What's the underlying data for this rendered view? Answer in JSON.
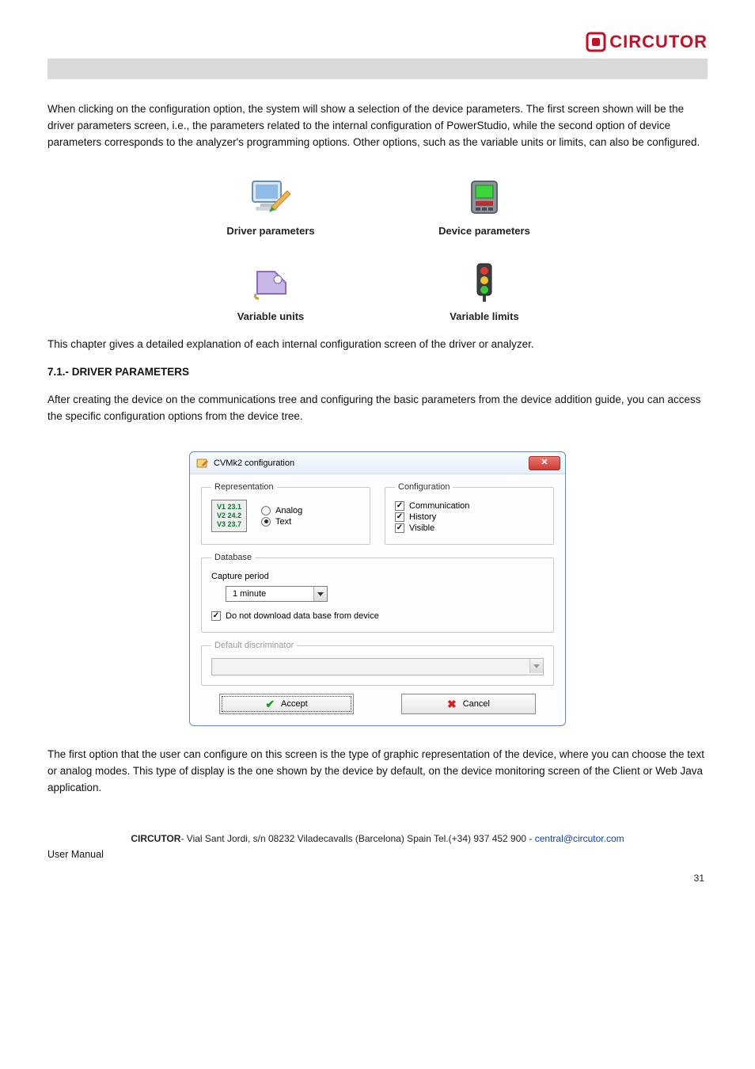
{
  "brand": "CIRCUTOR",
  "para1": "When clicking on the configuration option, the system will show a selection of the device parameters. The first screen shown will be the driver parameters screen, i.e., the parameters related to the internal configuration of PowerStudio, while the second option of device parameters corresponds to the analyzer's programming options. Other options, such as the variable units or limits, can also be configured.",
  "icons": {
    "driver": "Driver parameters",
    "device": "Device parameters",
    "units": "Variable units",
    "limits": "Variable limits"
  },
  "para2": "This chapter gives a detailed explanation of each internal configuration screen of the driver or analyzer.",
  "section_no": "7.1.-",
  "section_title": "DRIVER PARAMETERS",
  "para3": "After creating the device on the communications tree and configuring the basic parameters from the device addition guide, you can access the specific configuration options from the device tree.",
  "dialog": {
    "title": "CVMk2 configuration",
    "groups": {
      "representation": "Representation",
      "configuration": "Configuration",
      "database": "Database",
      "discriminator": "Default discriminator"
    },
    "mini": {
      "l1": "V1 23.1",
      "l2": "V2 24.2",
      "l3": "V3 23.7"
    },
    "radio": {
      "analog": "Analog",
      "text": "Text",
      "selected": "text"
    },
    "checks": {
      "communication": "Communication",
      "history": "History",
      "visible": "Visible"
    },
    "capture_label": "Capture period",
    "capture_value": "1 minute",
    "no_download": "Do not download data base from device",
    "accept": "Accept",
    "cancel": "Cancel"
  },
  "para4": "The first option that the user can configure on this screen is the type of graphic representation of the device, where you can choose the text or analog modes. This type of display is the one shown by the device by default, on the device monitoring screen of the Client or Web Java application.",
  "footer_brand": "CIRCUTOR",
  "footer_addr": "- Vial Sant Jordi, s/n  08232 Viladecavalls (Barcelona) Spain   Tel.(+34) 937 452 900 - ",
  "footer_mail": "central@circutor.com",
  "manual": "User Manual",
  "page": "31"
}
